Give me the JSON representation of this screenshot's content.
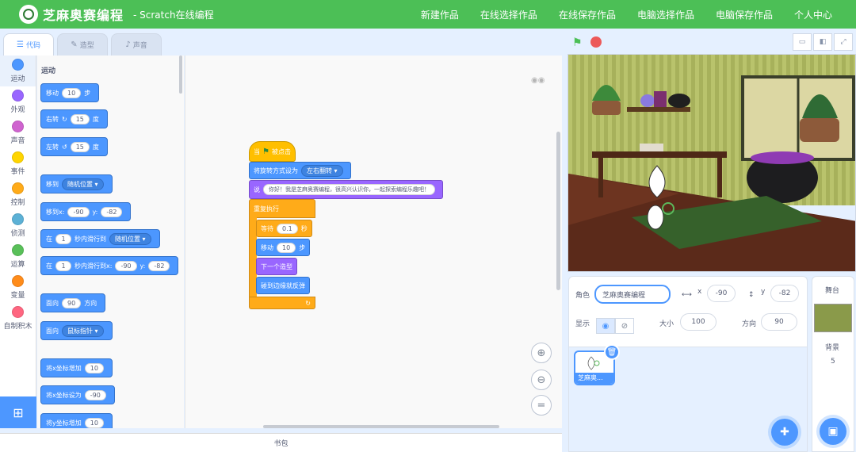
{
  "header": {
    "logo_text": "芝麻奥赛编程",
    "subtitle": "- Scratch在线编程",
    "nav": [
      "新建作品",
      "在线选择作品",
      "在线保存作品",
      "电脑选择作品",
      "电脑保存作品",
      "个人中心"
    ],
    "bg_color": "#4cbf56"
  },
  "tabs": [
    {
      "label": "代码",
      "icon": "code-icon",
      "active": true
    },
    {
      "label": "造型",
      "icon": "brush-icon"
    },
    {
      "label": "声音",
      "icon": "speaker-icon"
    }
  ],
  "categories": [
    {
      "label": "运动",
      "color": "#4c97ff"
    },
    {
      "label": "外观",
      "color": "#9966ff"
    },
    {
      "label": "声音",
      "color": "#cf63cf"
    },
    {
      "label": "事件",
      "color": "#ffd500"
    },
    {
      "label": "控制",
      "color": "#ffab19"
    },
    {
      "label": "侦测",
      "color": "#5cb1d6"
    },
    {
      "label": "运算",
      "color": "#59c059"
    },
    {
      "label": "变量",
      "color": "#ff8c1a"
    },
    {
      "label": "自制积木",
      "color": "#ff6680"
    }
  ],
  "palette": {
    "title": "运动",
    "move": {
      "label": "移动",
      "value": "10",
      "unit": "步"
    },
    "turn_right": {
      "label": "右转",
      "value": "15",
      "unit": "度"
    },
    "turn_left": {
      "label": "左转",
      "value": "15",
      "unit": "度"
    },
    "goto": {
      "label": "移到",
      "option": "随机位置"
    },
    "goto_xy": {
      "label": "移到x:",
      "x": "-90",
      "ylabel": "y:",
      "y": "-82"
    },
    "glide": {
      "label": "在",
      "secs": "1",
      "mid": "秒内滑行到",
      "option": "随机位置"
    },
    "glide_xy": {
      "label": "在",
      "secs": "1",
      "mid": "秒内滑行到x:",
      "x": "-90",
      "ylabel": "y:",
      "y": "-82"
    },
    "point_dir": {
      "label": "面向",
      "value": "90",
      "unit": "方向"
    },
    "point_towards": {
      "label": "面向",
      "option": "鼠标指针"
    },
    "change_x": {
      "label": "将x坐标增加",
      "value": "10"
    },
    "set_x": {
      "label": "将x坐标设为",
      "value": "-90"
    },
    "change_y": {
      "label": "将y坐标增加",
      "value": "10"
    }
  },
  "script": {
    "when_flag": {
      "pre": "当",
      "post": "被点击"
    },
    "rotation": {
      "label": "将旋转方式设为",
      "option": "左右翻转"
    },
    "say": {
      "label": "说",
      "text": "你好！我是芝麻奥赛编程，很高兴认识你，一起探索编程乐趣吧！"
    },
    "forever": {
      "label": "重复执行"
    },
    "wait": {
      "label": "等待",
      "value": "0.1",
      "unit": "秒"
    },
    "move": {
      "label": "移动",
      "value": "10",
      "unit": "步"
    },
    "next_costume": {
      "label": "下一个造型"
    },
    "bounce": {
      "label": "碰到边缘就反弹"
    }
  },
  "backpack_label": "书包",
  "sprite": {
    "label": "角色",
    "name": "芝麻奥赛编程",
    "x_label": "x",
    "x": "-90",
    "y_label": "y",
    "y": "-82",
    "show_label": "显示",
    "size_label": "大小",
    "size": "100",
    "dir_label": "方向",
    "dir": "90",
    "thumb_name": "芝麻奥..."
  },
  "stage_panel": {
    "title": "舞台",
    "backdrop_label": "背景",
    "backdrop_count": "5"
  }
}
